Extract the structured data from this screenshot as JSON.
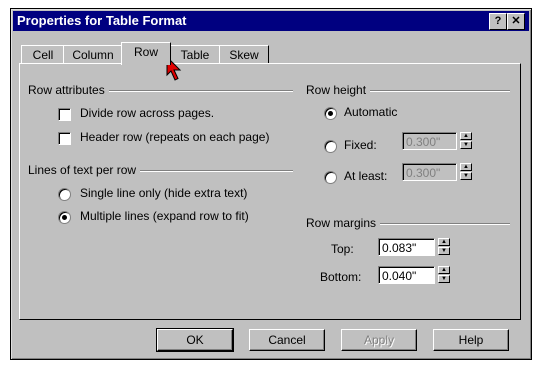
{
  "window": {
    "title": "Properties for Table Format",
    "help_label": "?",
    "close_label": "✕"
  },
  "tabs": [
    {
      "label": "Cell"
    },
    {
      "label": "Column"
    },
    {
      "label": "Row"
    },
    {
      "label": "Table"
    },
    {
      "label": "Skew"
    }
  ],
  "active_tab": "Row",
  "row_attributes": {
    "title": "Row attributes",
    "divide_label": "Divide row across pages.",
    "divide_checked": false,
    "header_label": "Header row (repeats on each page)",
    "header_checked": false
  },
  "lines_per_row": {
    "title": "Lines of text per row",
    "single_label": "Single line only (hide extra text)",
    "multiple_label": "Multiple lines (expand row to fit)",
    "selected": "Multiple lines (expand row to fit)"
  },
  "row_height": {
    "title": "Row height",
    "automatic_label": "Automatic",
    "fixed_label": "Fixed:",
    "fixed_value": "0.300\"",
    "atleast_label": "At least:",
    "atleast_value": "0.300\"",
    "selected": "Automatic"
  },
  "row_margins": {
    "title": "Row margins",
    "top_label": "Top:",
    "top_value": "0.083\"",
    "bottom_label": "Bottom:",
    "bottom_value": "0.040\""
  },
  "buttons": {
    "ok": "OK",
    "cancel": "Cancel",
    "apply": "Apply",
    "help": "Help"
  },
  "colors": {
    "titlebar": "#000080",
    "face": "#c0c0c0"
  }
}
